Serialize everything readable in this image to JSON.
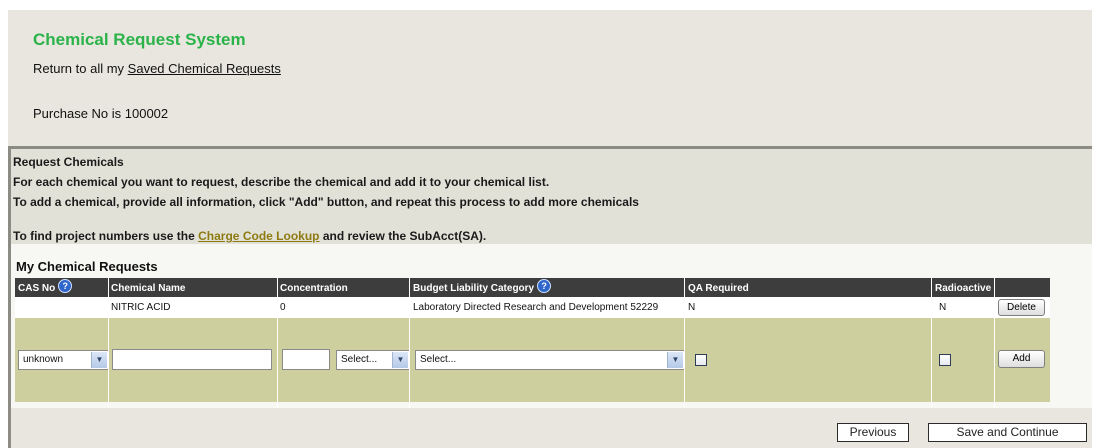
{
  "header": {
    "title": "Chemical Request System",
    "return_prefix": "Return to all my",
    "return_link": "Saved Chemical Requests",
    "purchase_no": "Purchase No is 100002"
  },
  "instructions": {
    "title": "Request Chemicals",
    "line1": "For each chemical you want to request, describe the chemical and add it to your chemical list.",
    "line2": "To add a chemical, provide all information, click \"Add\" button, and repeat this process to add more chemicals",
    "line3_prefix": "To find project numbers use the",
    "line3_link": "Charge Code Lookup",
    "line3_suffix": "and review the SubAcct(SA)."
  },
  "requests": {
    "heading": "My Chemical Requests",
    "columns": {
      "cas_no": "CAS No",
      "chemical_name": "Chemical Name",
      "concentration": "Concentration",
      "budget": "Budget Liability Category",
      "qa_required": "QA Required",
      "radioactive": "Radioactive"
    },
    "rows": [
      {
        "cas_no": "",
        "chemical_name": "NITRIC ACID",
        "concentration": "0",
        "budget": "Laboratory Directed Research and Development 52229",
        "qa_required": "N",
        "radioactive": "N",
        "action": "Delete"
      }
    ],
    "entry": {
      "cas_select": "unknown",
      "chemical_name_value": "",
      "concentration_value": "",
      "unit_select": "Select...",
      "budget_select": "Select...",
      "qa_checked": false,
      "radioactive_checked": false,
      "add_label": "Add"
    }
  },
  "footer": {
    "previous": "Previous",
    "save_continue": "Save and Continue"
  },
  "colors": {
    "title_green": "#2bb34a",
    "link_olive": "#8d7b12",
    "header_bg": "#3d3d3d",
    "entry_row_bg": "#cdcf9e",
    "page_bg": "#e8e6de"
  }
}
